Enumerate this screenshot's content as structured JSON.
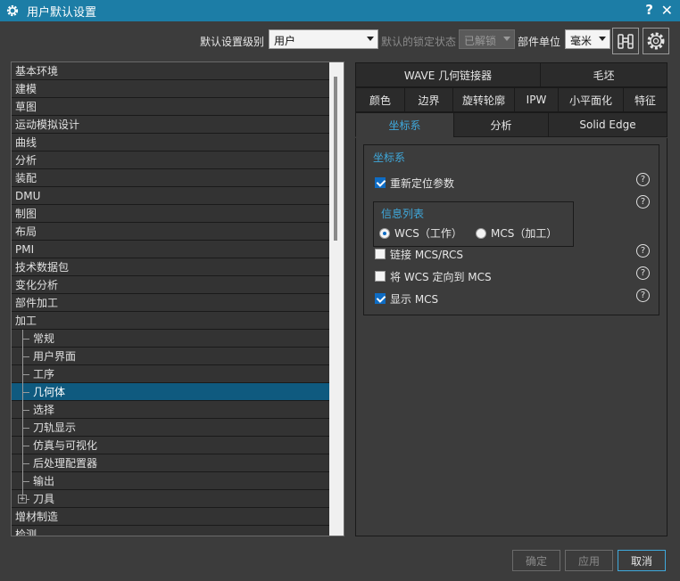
{
  "window": {
    "title": "用户默认设置",
    "help": "?",
    "close": "✕"
  },
  "toolbar": {
    "level_label": "默认设置级别",
    "level_value": "用户",
    "lock_label": "默认的锁定状态",
    "lock_value": "已解锁",
    "unit_label": "部件单位",
    "unit_value": "毫米"
  },
  "tree": {
    "items": [
      "基本环境",
      "建模",
      "草图",
      "运动模拟设计",
      "曲线",
      "分析",
      "装配",
      "DMU",
      "制图",
      "布局",
      "PMI",
      "技术数据包",
      "变化分析",
      "部件加工",
      "加工"
    ],
    "children": [
      "常规",
      "用户界面",
      "工序",
      "几何体",
      "选择",
      "刀轨显示",
      "仿真与可视化",
      "后处理配置器",
      "输出",
      "刀具"
    ],
    "after": [
      "增材制造",
      "检测"
    ],
    "selected": "几何体",
    "scroll_fraction": 0.35
  },
  "tabs": {
    "row1": [
      "WAVE 几何链接器",
      "毛坯"
    ],
    "row2": [
      "颜色",
      "边界",
      "旋转轮廓",
      "IPW",
      "小平面化",
      "特征"
    ],
    "row3": [
      "坐标系",
      "分析",
      "Solid Edge"
    ],
    "active": "坐标系"
  },
  "panel": {
    "group_title": "坐标系",
    "reposition_label": "重新定位参数",
    "reposition_checked": true,
    "info_title": "信息列表",
    "radio_wcs": "WCS（工作）",
    "radio_mcs": "MCS（加工）",
    "radio_selected": "WCS",
    "link_label": "链接 MCS/RCS",
    "link_checked": false,
    "orient_label": "将 WCS 定向到 MCS",
    "orient_checked": false,
    "show_label": "显示 MCS",
    "show_checked": true,
    "help_glyph": "?"
  },
  "buttons": {
    "ok": "确定",
    "apply": "应用",
    "cancel": "取消"
  },
  "colors": {
    "title_bar": "#1c7da6",
    "accent": "#3fa9dc",
    "selection": "#0f5a7f",
    "check": "#0e6cc4"
  }
}
